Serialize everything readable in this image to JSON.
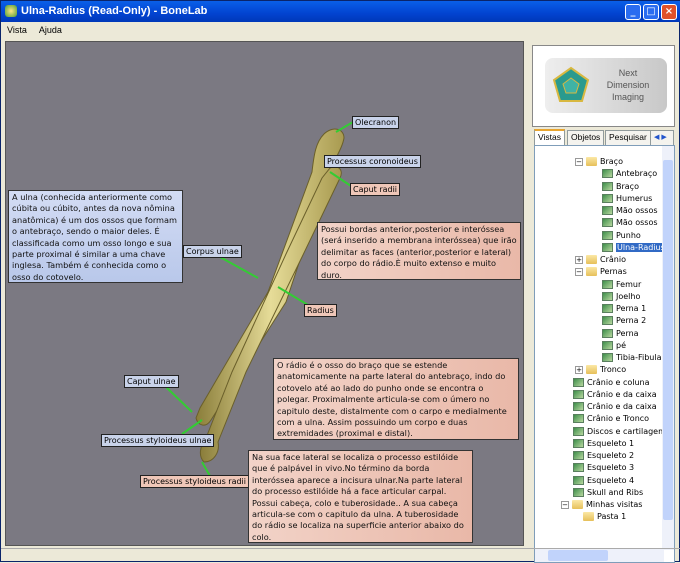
{
  "window": {
    "title": "Ulna-Radius (Read-Only) - BoneLab",
    "controls": [
      "minimize",
      "maximize",
      "close"
    ]
  },
  "menu": [
    "Vista",
    "Ajuda"
  ],
  "viewport": {
    "labels": {
      "olecranon": "Olecranon",
      "processus_coronoideus": "Processus coronoideus",
      "caput_radii": "Caput radii",
      "corpus_ulnae": "Corpus ulnae",
      "radius": "Radius",
      "caput_ulnae": "Caput ulnae",
      "processus_styloideus_ulnae": "Processus styloideus ulnae",
      "processus_styloideus_radii": "Processus styloideus radii"
    },
    "notes": {
      "ulna": "A ulna (conhecida anteriormente como cúbita ou cúbito, antes da nova nômina anatômica) é um dos ossos que formam o antebraço, sendo o maior deles. É classificada como um osso longo e sua parte proximal é similar a uma chave inglesa. Também é conhecida como o osso do cotovelo.",
      "radius_body": "Possui bordas anterior,posterior e interóssea (será inserido a membrana interóssea) que irão delimitar as faces (anterior,posterior e lateral) do corpo do rádio.È muito extenso e muito duro.",
      "radio": "O rádio é o osso do braço que se estende anatomicamente na parte lateral do antebraço, indo do cotovelo até ao lado do punho onde se encontra o polegar. Proximalmente articula-se com o úmero no capitulo deste, distalmente com o carpo e medialmente com a ulna. Assim possuindo um corpo e duas extremidades (proximal e distal).",
      "styloid": "Na sua face lateral se localiza o processo estilóide que é palpável in vivo.No término da borda interóssea aparece a incisura ulnar.Na parte lateral do processo estilóide há a face articular carpal. Possui cabeça, colo e tuberosidade.. A sua cabeça articula-se com o capitulo da ulna. A tuberosidade do rádio se localiza na superficie anterior abaixo do colo."
    }
  },
  "logo": {
    "line1": "Next",
    "line2": "Dimension",
    "line3": "Imaging"
  },
  "tabs": [
    "Vistas",
    "Objetos",
    "Pesquisar"
  ],
  "active_tab": "Vistas",
  "tree": [
    {
      "label": "Braço",
      "type": "folder",
      "level": 0,
      "expander": "−"
    },
    {
      "label": "Antebraço",
      "type": "view",
      "level": 1
    },
    {
      "label": "Braço",
      "type": "view",
      "level": 1
    },
    {
      "label": "Humerus",
      "type": "view",
      "level": 1
    },
    {
      "label": "Mão ossos",
      "type": "view",
      "level": 1
    },
    {
      "label": "Mão ossos",
      "type": "view",
      "level": 1
    },
    {
      "label": "Punho",
      "type": "view",
      "level": 1
    },
    {
      "label": "Ulna-Radius",
      "type": "view",
      "level": 1,
      "selected": true
    },
    {
      "label": "Crânio",
      "type": "folder",
      "level": 0,
      "expander": "+"
    },
    {
      "label": "Pernas",
      "type": "folder",
      "level": 0,
      "expander": "−"
    },
    {
      "label": "Femur",
      "type": "view",
      "level": 1
    },
    {
      "label": "Joelho",
      "type": "view",
      "level": 1
    },
    {
      "label": "Perna 1",
      "type": "view",
      "level": 1
    },
    {
      "label": "Perna 2",
      "type": "view",
      "level": 1
    },
    {
      "label": "Perna",
      "type": "view",
      "level": 1
    },
    {
      "label": "pé",
      "type": "view",
      "level": 1
    },
    {
      "label": "Tibia-Fibula",
      "type": "view",
      "level": 1
    },
    {
      "label": "Tronco",
      "type": "folder",
      "level": 0,
      "expander": "+"
    },
    {
      "label": "Crânio e coluna",
      "type": "view",
      "level": 0
    },
    {
      "label": "Crânio e da caixa",
      "type": "view",
      "level": 0
    },
    {
      "label": "Crânio e da caixa",
      "type": "view",
      "level": 0
    },
    {
      "label": "Crânio e Tronco",
      "type": "view",
      "level": 0
    },
    {
      "label": "Discos e cartilagem",
      "type": "view",
      "level": 0
    },
    {
      "label": "Esqueleto 1",
      "type": "view",
      "level": 0
    },
    {
      "label": "Esqueleto 2",
      "type": "view",
      "level": 0
    },
    {
      "label": "Esqueleto 3",
      "type": "view",
      "level": 0
    },
    {
      "label": "Esqueleto 4",
      "type": "view",
      "level": 0
    },
    {
      "label": "Skull and Ribs",
      "type": "view",
      "level": 0
    },
    {
      "label": "Minhas visitas",
      "type": "folder",
      "level": -1,
      "expander": "−"
    },
    {
      "label": "Pasta 1",
      "type": "folder",
      "level": 0
    }
  ],
  "colors": {
    "title_bar": "#0243d0",
    "viewport_bg": "#7b7982",
    "bone": "#d9d08a",
    "leader_line": "#33cc33",
    "selection": "#316ac5"
  }
}
